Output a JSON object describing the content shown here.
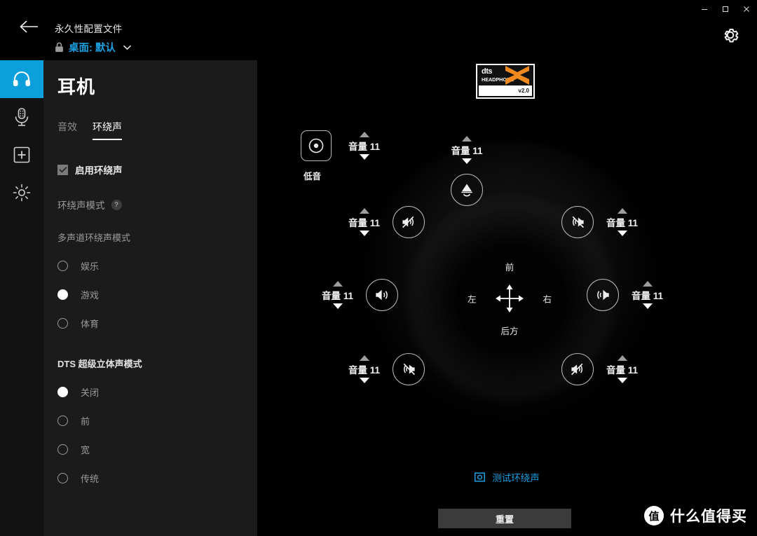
{
  "window": {
    "minimize_label": "–",
    "maximize_label": "□",
    "close_label": "✕"
  },
  "header": {
    "back_icon": "back-arrow-icon",
    "profile_title": "永久性配置文件",
    "lock_icon": "lock-icon",
    "profile_name": "桌面: 默认",
    "chevron_icon": "chevron-down-icon",
    "settings_icon": "gear-icon",
    "accent_color": "#1c9fe0"
  },
  "rail": {
    "items": [
      {
        "name": "headset",
        "icon": "headphone-icon",
        "active": true
      },
      {
        "name": "microphone",
        "icon": "microphone-icon",
        "active": false
      },
      {
        "name": "add-device",
        "icon": "plus-box-icon",
        "active": false
      },
      {
        "name": "lighting",
        "icon": "brightness-icon",
        "active": false
      }
    ],
    "active_color": "#0b9fdc"
  },
  "panel": {
    "title": "耳机",
    "tabs": [
      {
        "label": "音效",
        "active": false
      },
      {
        "label": "环绕声",
        "active": true
      }
    ],
    "enable_checkbox": {
      "label": "启用环绕声",
      "checked": true,
      "check_glyph": "✓"
    },
    "mode_section": {
      "label": "环绕声模式",
      "help_glyph": "?"
    },
    "multichannel": {
      "label": "多声道环绕声模式",
      "options": [
        {
          "label": "娱乐",
          "selected": false
        },
        {
          "label": "游戏",
          "selected": true
        },
        {
          "label": "体育",
          "selected": false
        }
      ]
    },
    "dts_stereo": {
      "label": "DTS 超级立体声模式",
      "options": [
        {
          "label": "关闭",
          "selected": true
        },
        {
          "label": "前",
          "selected": false
        },
        {
          "label": "宽",
          "selected": false
        },
        {
          "label": "传统",
          "selected": false
        }
      ]
    }
  },
  "stage": {
    "logo": {
      "brand": "dts",
      "line2": "HEADPHONE",
      "version": "v2.0",
      "mark_color": "#f08a1e"
    },
    "subwoofer": {
      "icon": "subwoofer-icon",
      "caption": "低音",
      "volume_label": "音量 11"
    },
    "speakers": [
      {
        "name": "center",
        "icon": "center-speaker-icon",
        "volume_label": "音量 11"
      },
      {
        "name": "front-left",
        "icon": "speaker-muted-icon",
        "volume_label": "音量 11"
      },
      {
        "name": "front-right",
        "icon": "speaker-muted-icon",
        "volume_label": "音量 11"
      },
      {
        "name": "side-left",
        "icon": "speaker-active-icon",
        "volume_label": "音量 11"
      },
      {
        "name": "side-right",
        "icon": "speaker-active-icon",
        "volume_label": "音量 11"
      },
      {
        "name": "rear-left",
        "icon": "speaker-muted-icon",
        "volume_label": "音量 11"
      },
      {
        "name": "rear-right",
        "icon": "speaker-muted-icon",
        "volume_label": "音量 11"
      }
    ],
    "compass": {
      "front": "前",
      "rear": "后方",
      "left": "左",
      "right": "右",
      "icon": "move-arrows-icon"
    },
    "test": {
      "icon": "test-sound-icon",
      "label": "测试环绕声",
      "color": "#1c9fe0"
    },
    "reset_button": "重置"
  },
  "watermark": {
    "badge": "值",
    "text": "什么值得买"
  }
}
